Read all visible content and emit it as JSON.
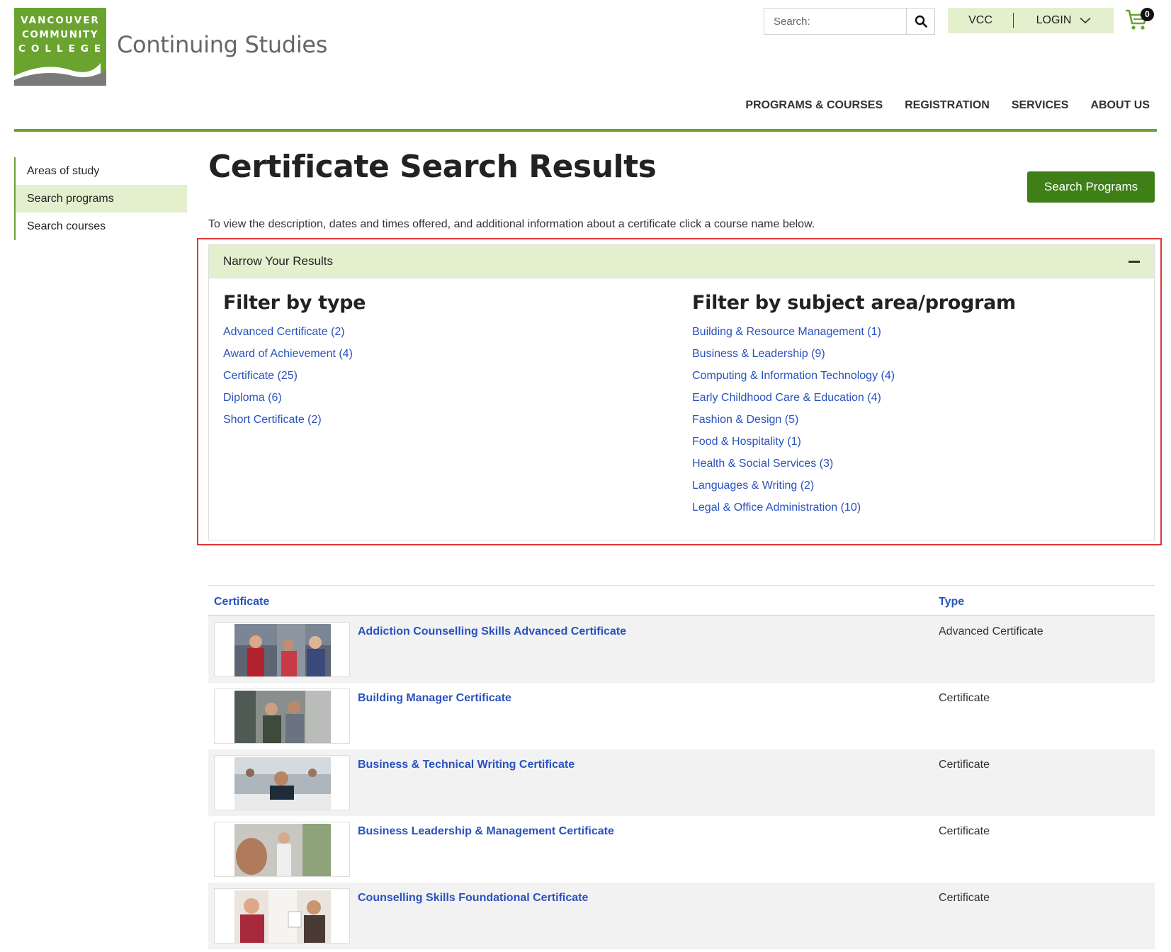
{
  "header": {
    "logo_lines": [
      "VANCOUVER",
      "COMMUNITY",
      "COLLEGE"
    ],
    "site_name": "Continuing Studies",
    "search_placeholder": "Search:",
    "account": {
      "vcc_label": "VCC",
      "login_label": "LOGIN"
    },
    "cart_count": "0",
    "nav": [
      "PROGRAMS & COURSES",
      "REGISTRATION",
      "SERVICES",
      "ABOUT US"
    ]
  },
  "sidebar": {
    "items": [
      {
        "label": "Areas of study",
        "active": false
      },
      {
        "label": "Search programs",
        "active": true
      },
      {
        "label": "Search courses",
        "active": false
      }
    ]
  },
  "main": {
    "title": "Certificate Search Results",
    "search_programs_label": "Search Programs",
    "intro": "To view the description, dates and times offered, and additional information about a certificate click a course name below."
  },
  "narrow": {
    "title": "Narrow Your Results",
    "type_heading": "Filter by type",
    "types": [
      "Advanced Certificate (2)",
      "Award of Achievement (4)",
      "Certificate (25)",
      "Diploma (6)",
      "Short Certificate (2)"
    ],
    "subject_heading": "Filter by subject area/program",
    "subjects": [
      "Building & Resource Management (1)",
      "Business & Leadership (9)",
      "Computing & Information Technology (4)",
      "Early Childhood Care & Education (4)",
      "Fashion & Design (5)",
      "Food & Hospitality (1)",
      "Health & Social Services (3)",
      "Languages & Writing (2)",
      "Legal & Office Administration (10)"
    ]
  },
  "results": {
    "col_certificate": "Certificate",
    "col_type": "Type",
    "rows": [
      {
        "title": "Addiction Counselling Skills Advanced Certificate",
        "type": "Advanced Certificate"
      },
      {
        "title": "Building Manager Certificate",
        "type": "Certificate"
      },
      {
        "title": "Business & Technical Writing Certificate",
        "type": "Certificate"
      },
      {
        "title": "Business Leadership & Management Certificate",
        "type": "Certificate"
      },
      {
        "title": "Counselling Skills Foundational Certificate",
        "type": "Certificate"
      }
    ]
  },
  "colors": {
    "brand_green": "#6aa42f",
    "button_green": "#3e7f17",
    "light_green": "#e3efcd",
    "link_blue": "#2a52be",
    "highlight_red": "#e0363a"
  }
}
